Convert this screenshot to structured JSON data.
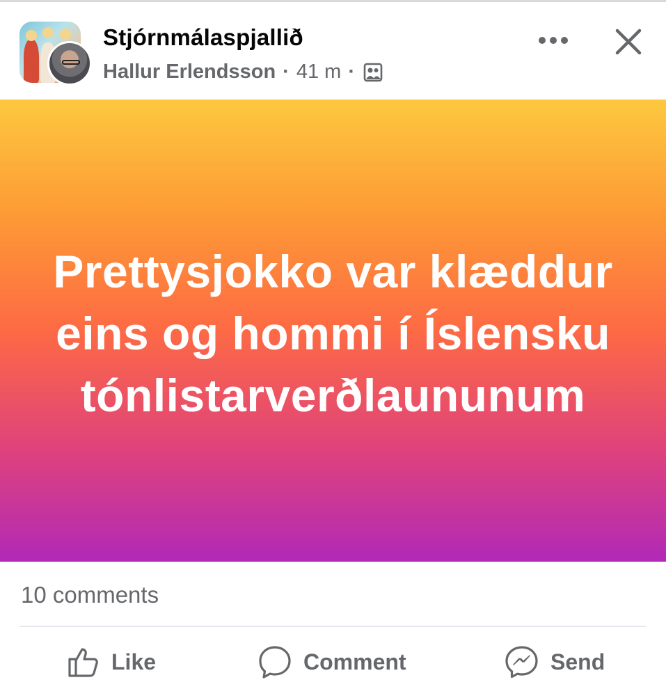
{
  "post": {
    "group_name": "Stjórnmálaspjallið",
    "author": "Hallur Erlendsson",
    "separator": "·",
    "time": "41 m",
    "audience_icon": "group-members-icon",
    "more_icon": "more-dots-icon",
    "close_icon": "close-icon",
    "text": "Prettysjokko var klæddur eins og hommi í Íslensku tónlistarverðlaununum",
    "background_gradient": [
      "#fdc83f",
      "#fd6a44",
      "#b129b7"
    ],
    "comments_count": "10 comments"
  },
  "actions": {
    "like": {
      "label": "Like",
      "icon": "thumbs-up-icon"
    },
    "comment": {
      "label": "Comment",
      "icon": "comment-bubble-icon"
    },
    "send": {
      "label": "Send",
      "icon": "messenger-icon"
    }
  }
}
